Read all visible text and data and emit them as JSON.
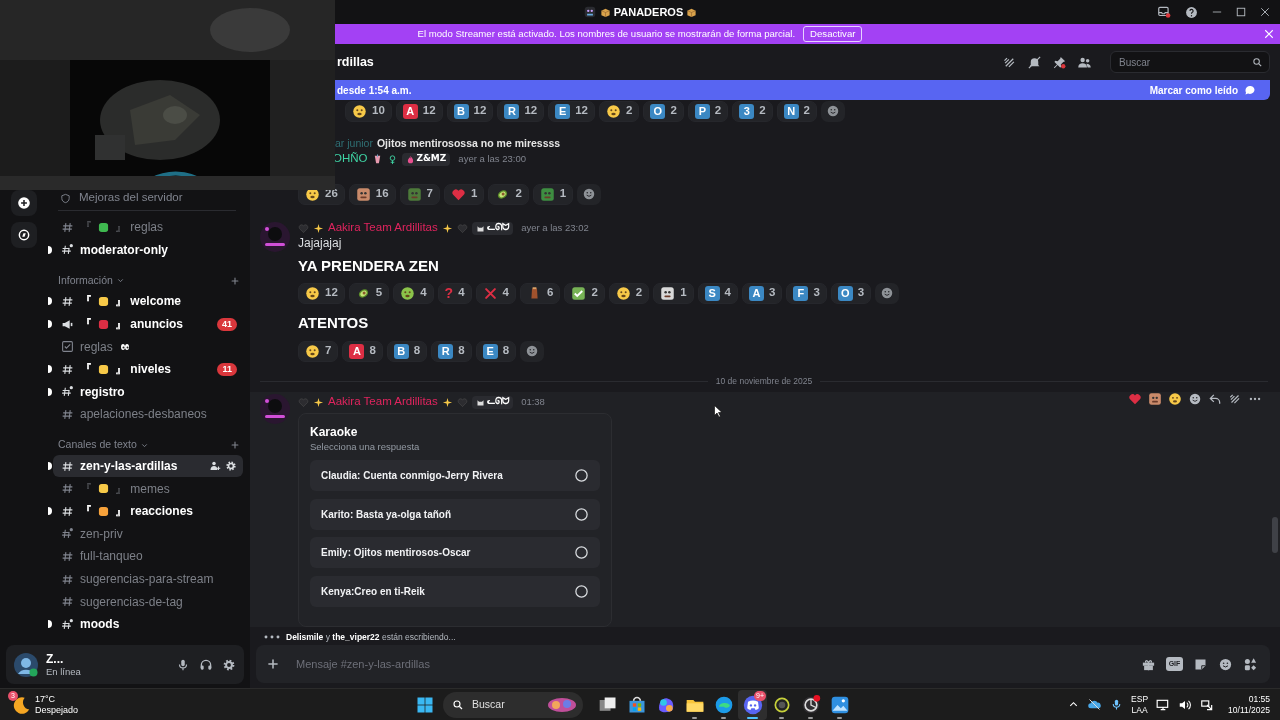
{
  "window": {
    "title": "PANADEROS"
  },
  "streamer_banner": {
    "text": "El modo Streamer está activado. Los nombres de usuario se mostrarán de forma parcial.",
    "button": "Desactivar"
  },
  "server_rail": [
    {
      "kind": "add"
    },
    {
      "kind": "discover"
    }
  ],
  "sidebar": {
    "boost_item": "Mejoras del servidor",
    "channels": [
      {
        "kind": "text",
        "label": "reglas",
        "unread": false,
        "selected": false,
        "tag": {
          "open": "『",
          "close": "』",
          "color": "#3fb950"
        }
      },
      {
        "kind": "private",
        "label": "moderator-only",
        "unread": true,
        "selected": false
      },
      {
        "kind": "category",
        "label": "Información"
      },
      {
        "kind": "text",
        "label": "welcome",
        "unread": true,
        "selected": false,
        "tag": {
          "open": "『",
          "close": "』",
          "color": "#f7c948"
        }
      },
      {
        "kind": "announcement",
        "label": "anuncios",
        "unread": true,
        "selected": false,
        "badge": "41",
        "tag": {
          "open": "『",
          "close": "』",
          "color": "#dd2e44"
        }
      },
      {
        "kind": "rules",
        "label": "reglas",
        "unread": false,
        "selected": false,
        "trailing_emoji": true
      },
      {
        "kind": "text",
        "label": "niveles",
        "unread": true,
        "selected": false,
        "badge": "11",
        "tag": {
          "open": "『",
          "close": "』",
          "color": "#f7c948"
        }
      },
      {
        "kind": "private",
        "label": "registro",
        "unread": true,
        "selected": false
      },
      {
        "kind": "text",
        "label": "apelaciones-desbaneos",
        "unread": false,
        "selected": false
      },
      {
        "kind": "category",
        "label": "Canales de texto"
      },
      {
        "kind": "text",
        "label": "zen-y-las-ardillas",
        "unread": true,
        "selected": true
      },
      {
        "kind": "text",
        "label": "memes",
        "unread": false,
        "selected": false,
        "tag": {
          "open": "『",
          "close": "』",
          "color": "#f7c948"
        }
      },
      {
        "kind": "text",
        "label": "reacciones",
        "unread": true,
        "selected": false,
        "tag": {
          "open": "『",
          "close": "』",
          "color": "#f7a23b"
        }
      },
      {
        "kind": "private",
        "label": "zen-priv",
        "unread": false,
        "selected": false
      },
      {
        "kind": "text",
        "label": "full-tanqueo",
        "unread": false,
        "selected": false
      },
      {
        "kind": "text",
        "label": "sugerencias-para-stream",
        "unread": false,
        "selected": false
      },
      {
        "kind": "text",
        "label": "sugerencias-de-tag",
        "unread": false,
        "selected": false
      },
      {
        "kind": "private",
        "label": "moods",
        "unread": true,
        "selected": false
      }
    ]
  },
  "user_panel": {
    "name": "Z...",
    "status": "En línea"
  },
  "channel_header": {
    "name": "rdillas",
    "search": {
      "placeholder": "Buscar"
    }
  },
  "new_messages_bar": {
    "text": "desde 1:54 a.m.",
    "action": "Marcar como leído"
  },
  "messages": [
    {
      "kind": "continuation",
      "blocks": [
        {
          "kind": "reactions",
          "reactions": [
            {
              "kind": "face",
              "color": "#f7c948",
              "count": "10"
            },
            {
              "kind": "letter",
              "label": "A",
              "color": "#dd2e44",
              "count": "12"
            },
            {
              "kind": "letter",
              "label": "B",
              "color": "#3b88c3",
              "count": "12"
            },
            {
              "kind": "letter",
              "label": "R",
              "color": "#3b88c3",
              "count": "12"
            },
            {
              "kind": "letter",
              "label": "E",
              "color": "#3b88c3",
              "count": "12"
            },
            {
              "kind": "face",
              "color": "#f7c948",
              "count": "2"
            },
            {
              "kind": "letter",
              "label": "O",
              "color": "#3b88c3",
              "count": "2"
            },
            {
              "kind": "letter",
              "label": "P",
              "color": "#3b88c3",
              "count": "2"
            },
            {
              "kind": "letter",
              "label": "3",
              "color": "#3b88c3",
              "count": "2"
            },
            {
              "kind": "letter",
              "label": "N",
              "color": "#3b88c3",
              "count": "2"
            }
          ]
        }
      ]
    },
    {
      "kind": "reply",
      "reply": {
        "author": "ar junior",
        "text": "Ojitos mentirosossa no me miressss"
      },
      "author": "OHÑO",
      "color": "#3fd4a4",
      "tag": "Z&MZ",
      "time": "ayer a las 23:00",
      "blocks": [
        {
          "kind": "reactions",
          "reactions": [
            {
              "kind": "face",
              "color": "#f7c948",
              "count": "26"
            },
            {
              "color": "#c98a6a",
              "count": "16"
            },
            {
              "color": "#4d7a3a",
              "count": "7"
            },
            {
              "kind": "heart",
              "count": "1"
            },
            {
              "kind": "avocado",
              "count": "2"
            },
            {
              "color": "#3e8e41",
              "count": "1"
            }
          ]
        }
      ]
    },
    {
      "kind": "message",
      "author": "Aakira Team Ardillitas",
      "color": "#e0245e",
      "tag": "ᓚᘏᗢ",
      "time": "ayer a las 23:02",
      "hovered": false,
      "blocks": [
        {
          "kind": "text",
          "text": "Jajajajaj"
        },
        {
          "kind": "heading",
          "text": "YA PRENDERA ZEN"
        },
        {
          "kind": "reactions",
          "reactions": [
            {
              "kind": "face",
              "color": "#f7c948",
              "count": "12"
            },
            {
              "kind": "avocado",
              "count": "5"
            },
            {
              "kind": "face",
              "color": "#8bc34a",
              "count": "4"
            },
            {
              "kind": "symbol",
              "label": "?",
              "color": "#dd2e44",
              "count": "4"
            },
            {
              "kind": "cross",
              "count": "4"
            },
            {
              "kind": "cup",
              "count": "6"
            },
            {
              "kind": "check",
              "count": "2"
            },
            {
              "kind": "face",
              "color": "#f7c948",
              "count": "2"
            },
            {
              "color": "#d9d9d9",
              "count": "1"
            },
            {
              "kind": "letter",
              "label": "S",
              "color": "#3b88c3",
              "count": "4"
            },
            {
              "kind": "letter",
              "label": "A",
              "color": "#3b88c3",
              "count": "3"
            },
            {
              "kind": "letter",
              "label": "F",
              "color": "#3b88c3",
              "count": "3"
            },
            {
              "kind": "letter",
              "label": "O",
              "color": "#3b88c3",
              "count": "3"
            }
          ]
        },
        {
          "kind": "heading",
          "text": "ATENTOS"
        },
        {
          "kind": "reactions",
          "reactions": [
            {
              "kind": "face",
              "color": "#f7c948",
              "count": "7"
            },
            {
              "kind": "letter",
              "label": "A",
              "color": "#dd2e44",
              "count": "8"
            },
            {
              "kind": "letter",
              "label": "B",
              "color": "#3b88c3",
              "count": "8"
            },
            {
              "kind": "letter",
              "label": "R",
              "color": "#3b88c3",
              "count": "8"
            },
            {
              "kind": "letter",
              "label": "E",
              "color": "#3b88c3",
              "count": "8"
            }
          ]
        }
      ]
    },
    {
      "kind": "divider",
      "text": "10 de noviembre de 2025"
    },
    {
      "kind": "message",
      "author": "Aakira Team Ardillitas",
      "color": "#e0245e",
      "tag": "ᓚᘏᗢ",
      "time": "01:38",
      "hovered": true,
      "blocks": [
        {
          "kind": "poll",
          "title": "Karaoke",
          "subtitle": "Selecciona una respuesta",
          "options": [
            {
              "label": "Claudia: Cuenta conmigo-Jerry Rivera",
              "selected": false
            },
            {
              "label": "Karito: Basta ya-olga tañoñ",
              "selected": false
            },
            {
              "label": "Emily: Ojitos mentirosos-Oscar",
              "selected": false
            },
            {
              "label": "Kenya:Creo en ti-Reik",
              "selected": false
            }
          ]
        }
      ]
    }
  ],
  "typing": "**Delismile** y **the_viper22** están escribiendo...",
  "composer": {
    "placeholder": "Mensaje #zen-y-las-ardillas",
    "tools": [
      {
        "kind": "gift"
      },
      {
        "kind": "gif",
        "label": "GIF"
      },
      {
        "kind": "sticker"
      },
      {
        "kind": "emoji"
      },
      {
        "kind": "apps"
      }
    ]
  },
  "taskbar": {
    "weather": {
      "temp": "17°C",
      "condition": "Despejado",
      "badge": "3"
    },
    "search": {
      "placeholder": "Buscar"
    },
    "apps": [
      {
        "kind": "task-view",
        "running": false,
        "selected": false
      },
      {
        "kind": "store",
        "running": false,
        "selected": false
      },
      {
        "kind": "copilot",
        "running": false,
        "selected": false
      },
      {
        "kind": "files",
        "running": true,
        "selected": false
      },
      {
        "kind": "edge",
        "running": true,
        "selected": false
      },
      {
        "kind": "discord",
        "running": true,
        "selected": true,
        "badge": "9+"
      },
      {
        "kind": "ring",
        "running": true,
        "selected": false
      },
      {
        "kind": "aperture",
        "running": true,
        "selected": false
      },
      {
        "kind": "photos",
        "running": true,
        "selected": false
      }
    ],
    "tray": {
      "language": "ESP",
      "layout": "LAA",
      "time": "01:55",
      "date": "10/11/2025"
    }
  }
}
